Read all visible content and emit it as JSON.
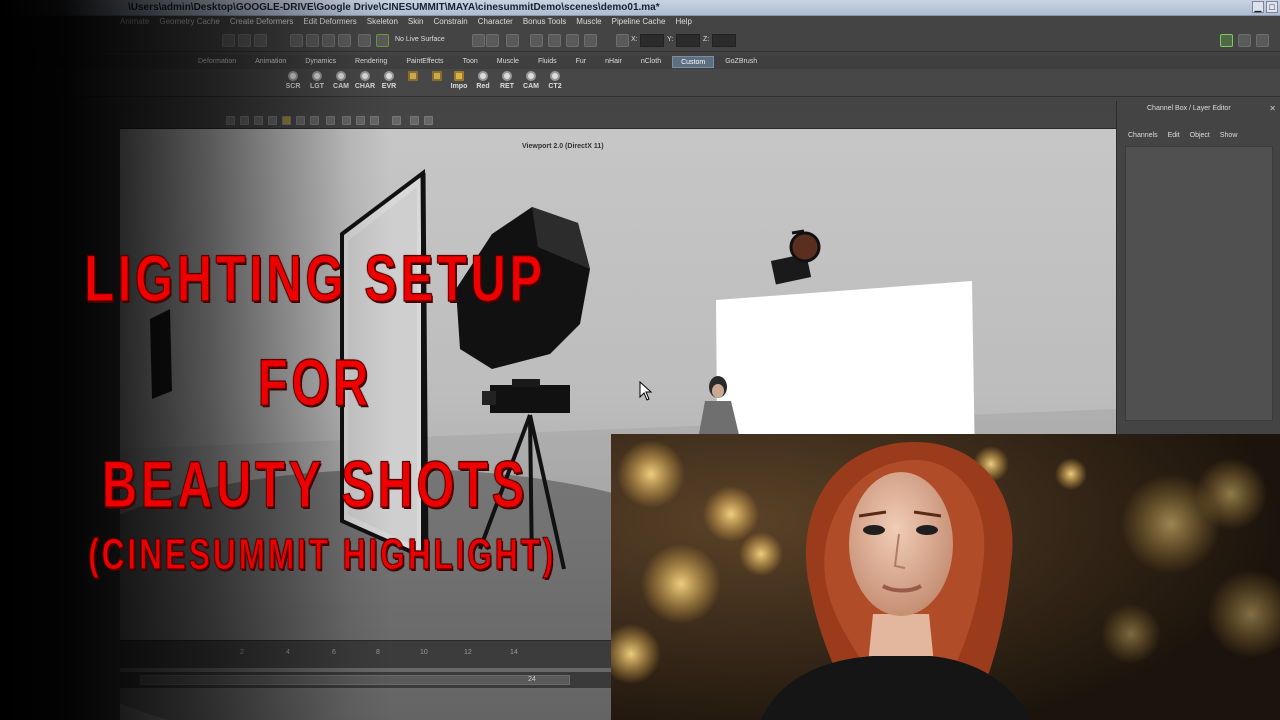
{
  "window": {
    "title": "\\Users\\admin\\Desktop\\GOOGLE-DRIVE\\Google Drive\\CINESUMMIT\\MAYA\\cinesummitDemo\\scenes\\demo01.ma*",
    "minimize": "▁",
    "close": "□"
  },
  "menu": [
    "Animate",
    "Geometry Cache",
    "Create Deformers",
    "Edit Deformers",
    "Skeleton",
    "Skin",
    "Constrain",
    "Character",
    "Bonus Tools",
    "Muscle",
    "Pipeline Cache",
    "Help"
  ],
  "statusline": {
    "live_surface": "No Live Surface",
    "x_label": "X:",
    "y_label": "Y:",
    "z_label": "Z:"
  },
  "shelf_tabs": [
    "Deformation",
    "Animation",
    "Dynamics",
    "Rendering",
    "PaintEffects",
    "Toon",
    "Muscle",
    "Fluids",
    "Fur",
    "nHair",
    "nCloth",
    "Custom",
    "GoZBrush"
  ],
  "active_shelf_tab": "Custom",
  "shelf_buttons": [
    "SCR",
    "LGT",
    "CAM",
    "CHAR",
    "EVR",
    "",
    "Impo",
    "Red",
    "RET",
    "CAM",
    "CT2"
  ],
  "viewport": {
    "label": "Viewport 2.0 (DirectX 11)"
  },
  "channel_box": {
    "title": "Channel Box / Layer Editor",
    "menu": [
      "Channels",
      "Edit",
      "Object",
      "Show"
    ]
  },
  "timeline": {
    "ticks": [
      "2",
      "4",
      "6",
      "8",
      "10",
      "12",
      "14"
    ],
    "current": "24"
  },
  "headline": {
    "line1": "LIGHTING SETUP",
    "line2": "FOR",
    "line3": "BEAUTY SHOTS",
    "line4": "(CINESUMMIT HIGHLIGHT)"
  },
  "colors": {
    "headline": "#ee0000",
    "viewport_bg": "#c0c0c0",
    "ui_bg": "#444444",
    "active_tab": "#5d6e80"
  }
}
